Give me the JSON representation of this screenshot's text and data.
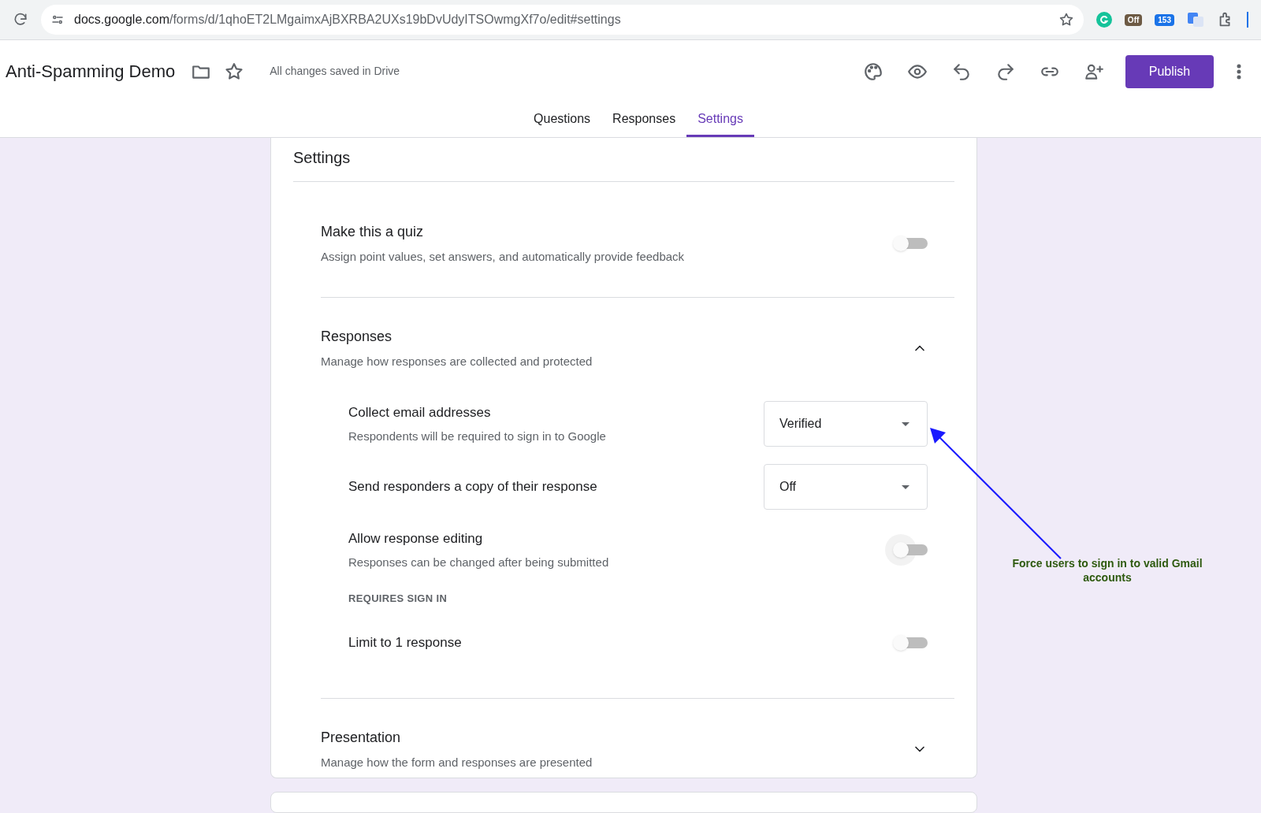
{
  "browser": {
    "url_host": "docs.google.com",
    "url_path": "/forms/d/1qhoET2LMgaimxAjBXRBA2UXs19bDvUdyITSOwmgXf7o/edit#settings",
    "extension_badges": [
      "Off",
      "153"
    ]
  },
  "header": {
    "title": "Anti-Spamming Demo",
    "save_status": "All changes saved in Drive",
    "publish_button": "Publish"
  },
  "tabs": [
    {
      "label": "Questions",
      "selected": false
    },
    {
      "label": "Responses",
      "selected": false
    },
    {
      "label": "Settings",
      "selected": true
    }
  ],
  "settings": {
    "title": "Settings",
    "sections": [
      {
        "kind": "toggle",
        "title": "Make this a quiz",
        "description": "Assign point values, set answers, and automatically provide feedback",
        "on": false
      },
      {
        "kind": "expandable",
        "title": "Responses",
        "description": "Manage how responses are collected and protected",
        "expanded": true,
        "items": [
          {
            "kind": "dropdown",
            "label": "Collect email addresses",
            "description": "Respondents will be required to sign in to Google",
            "value": "Verified"
          },
          {
            "kind": "dropdown",
            "label": "Send responders a copy of their response",
            "value": "Off"
          },
          {
            "kind": "toggle",
            "label": "Allow response editing",
            "description": "Responses can be changed after being submitted",
            "on": false,
            "focused": true
          },
          {
            "kind": "subheading",
            "label": "REQUIRES SIGN IN"
          },
          {
            "kind": "toggle",
            "label": "Limit to 1 response",
            "on": false,
            "focused": false
          }
        ]
      },
      {
        "kind": "expandable",
        "title": "Presentation",
        "description": "Manage how the form and responses are presented",
        "expanded": false
      }
    ]
  },
  "annotation": {
    "text": "Force users to sign in to valid Gmail accounts"
  }
}
